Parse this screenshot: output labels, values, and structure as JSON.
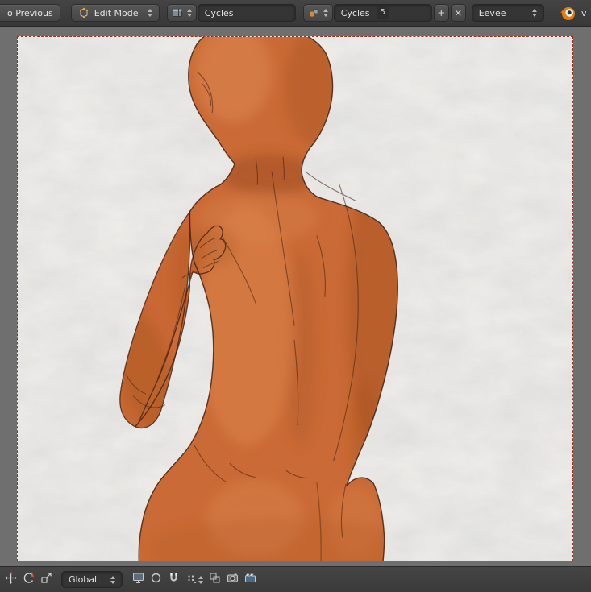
{
  "header": {
    "back_button_label": "o Previous",
    "mode_dropdown_label": "Edit Mode",
    "screen_layout_name": "Cycles",
    "scene_name": "Cycles",
    "scene_users_count": "5",
    "engine_dropdown_label": "Eevee",
    "version_text": "v"
  },
  "icons": {
    "plus": "+",
    "close": "×"
  },
  "toolbar": {
    "orientation_dropdown_label": "Global"
  },
  "viewport": {
    "camera_border_color": "#8a3326",
    "background_color": "#f2f1ed",
    "surround_color": "#6f6f6f",
    "figure": {
      "description": "orange clay base-mesh female figure, back view, bald head, left hand raised to shoulder",
      "skin_color": "#ca6a36",
      "shadow_color": "#a5521f",
      "highlight_color": "#e08a50",
      "outline_color": "#3d2013"
    }
  },
  "colors": {
    "header_bg": "#3b3b3b",
    "widget_bg": "#4d4d4d",
    "field_bg": "#353535",
    "text": "#e2e2e2",
    "blender_orange": "#e87d0d"
  }
}
